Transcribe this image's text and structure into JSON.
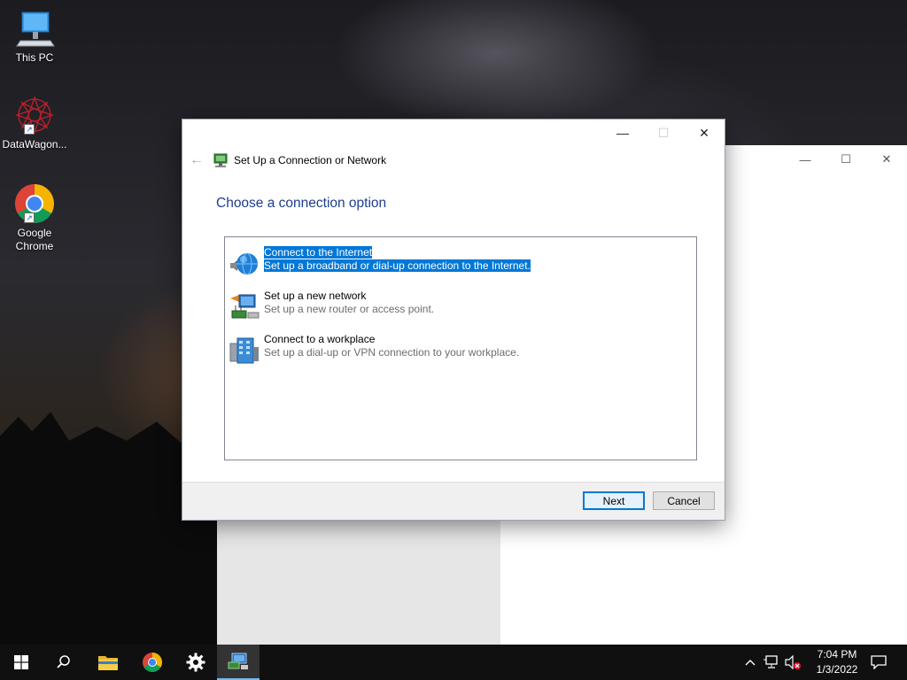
{
  "desktop": {
    "icons": [
      {
        "label": "This PC"
      },
      {
        "label": "DataWagon..."
      },
      {
        "label": "Google Chrome"
      }
    ]
  },
  "background_window": {
    "controls": {
      "minimize": "—",
      "maximize": "☐",
      "close": "✕"
    }
  },
  "dialog": {
    "title": "Set Up a Connection or Network",
    "heading": "Choose a connection option",
    "controls": {
      "minimize": "—",
      "maximize": "☐",
      "close": "✕"
    },
    "back_icon": "←",
    "options": [
      {
        "title": "Connect to the Internet",
        "description": "Set up a broadband or dial-up connection to the Internet.",
        "selected": true,
        "icon": "globe-icon"
      },
      {
        "title": "Set up a new network",
        "description": "Set up a new router or access point.",
        "selected": false,
        "icon": "network-icon"
      },
      {
        "title": "Connect to a workplace",
        "description": "Set up a dial-up or VPN connection to your workplace.",
        "selected": false,
        "icon": "workplace-icon"
      }
    ],
    "buttons": {
      "next": "Next",
      "cancel": "Cancel"
    }
  },
  "taskbar": {
    "time": "7:04 PM",
    "date": "1/3/2022",
    "tray_chevron": "^"
  },
  "colors": {
    "accent": "#0078d7",
    "heading": "#1e3d8f",
    "taskbar": "#101010"
  }
}
